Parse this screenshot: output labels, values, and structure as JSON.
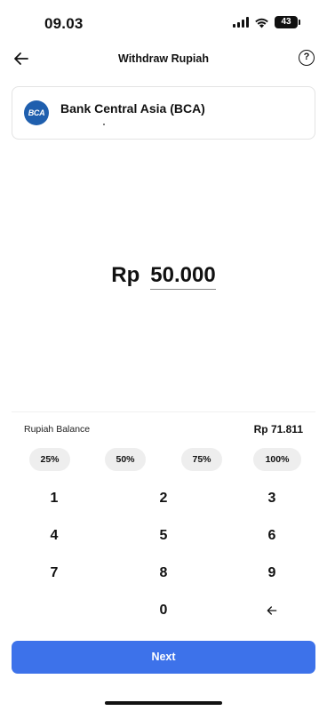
{
  "status": {
    "time": "09.03",
    "battery": "43"
  },
  "header": {
    "title": "Withdraw Rupiah",
    "back_icon": "arrow-left-icon",
    "help_icon": "question-circle-icon",
    "help_glyph": "?"
  },
  "bank": {
    "logo_text": "BCA",
    "name": "Bank Central Asia (BCA)",
    "brand_color": "#1f5fae"
  },
  "amount": {
    "currency": "Rp",
    "value": "50.000"
  },
  "balance": {
    "label": "Rupiah Balance",
    "value": "Rp 71.811"
  },
  "percent_options": [
    "25%",
    "50%",
    "75%",
    "100%"
  ],
  "keypad": {
    "keys": [
      "1",
      "2",
      "3",
      "4",
      "5",
      "6",
      "7",
      "8",
      "9",
      "0"
    ],
    "backspace_icon": "arrow-left-icon"
  },
  "next": {
    "label": "Next",
    "color": "#3d72ea"
  }
}
